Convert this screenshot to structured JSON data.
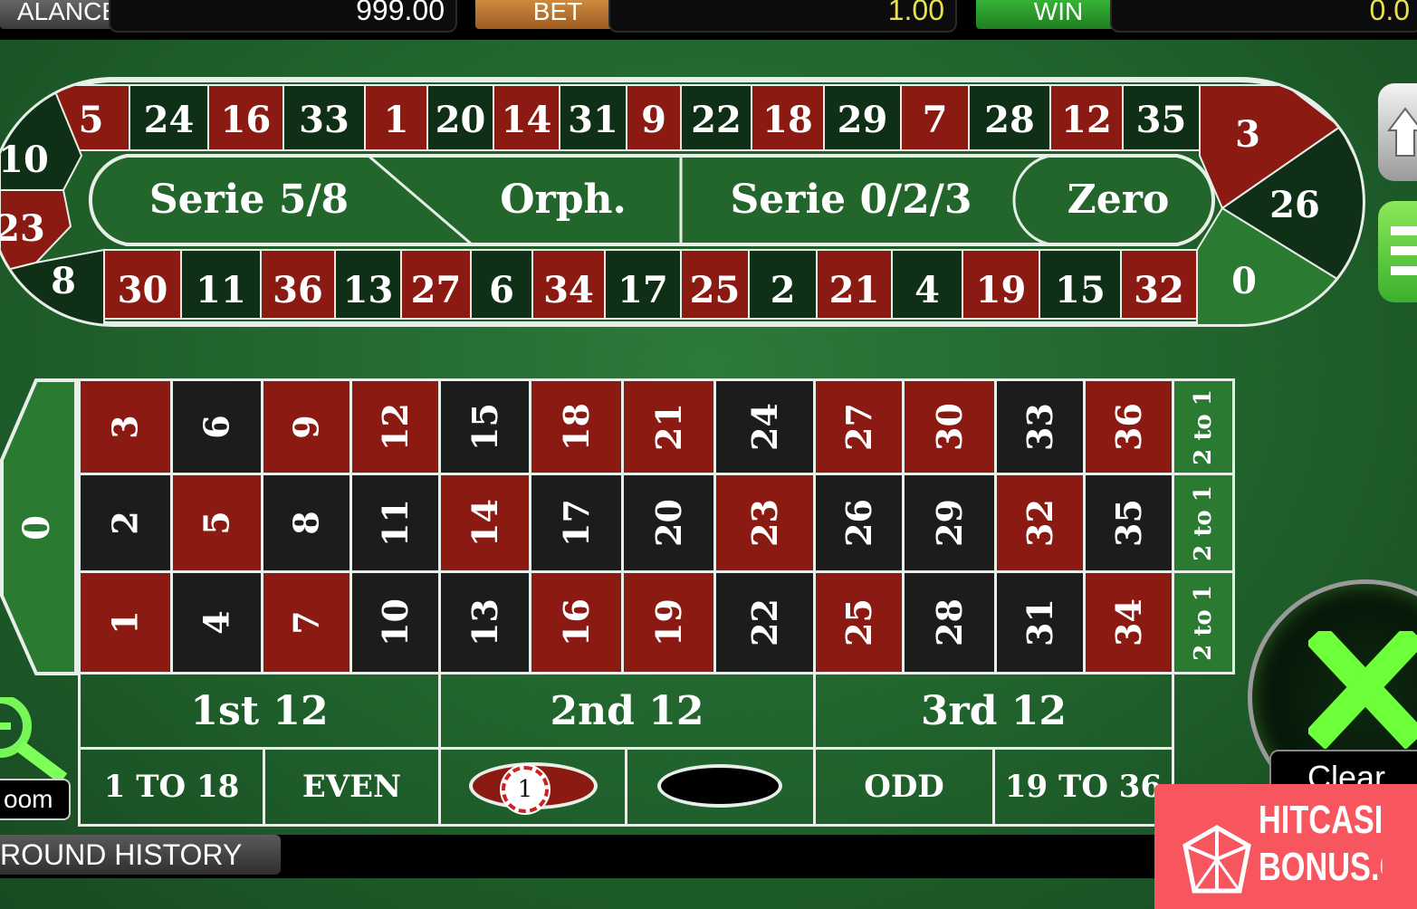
{
  "topbar": {
    "balance_label": "ALANCE",
    "balance_value": "999.00",
    "bet_label": "BET",
    "bet_value": "1.00",
    "win_label": "WIN",
    "win_value": "0.0",
    "colors": {
      "bet": "#b8742e",
      "win": "#2f9b2f"
    }
  },
  "racetrack": {
    "top_row": [
      "5",
      "24",
      "16",
      "33",
      "1",
      "20",
      "14",
      "31",
      "9",
      "22",
      "18",
      "29",
      "7",
      "28",
      "12",
      "35"
    ],
    "bottom_row": [
      "30",
      "11",
      "36",
      "13",
      "27",
      "6",
      "34",
      "17",
      "25",
      "2",
      "21",
      "4",
      "19",
      "15",
      "32"
    ],
    "left_end": [
      "10",
      "23",
      "8"
    ],
    "right_end": [
      "3",
      "26",
      "0"
    ],
    "sections": [
      "Serie 5/8",
      "Orph.",
      "Serie 0/2/3",
      "Zero"
    ]
  },
  "table": {
    "zero": "0",
    "rows": [
      [
        "3",
        "6",
        "9",
        "12",
        "15",
        "18",
        "21",
        "24",
        "27",
        "30",
        "33",
        "36"
      ],
      [
        "2",
        "5",
        "8",
        "11",
        "14",
        "17",
        "20",
        "23",
        "26",
        "29",
        "32",
        "35"
      ],
      [
        "1",
        "4",
        "7",
        "10",
        "13",
        "16",
        "19",
        "22",
        "25",
        "28",
        "31",
        "34"
      ]
    ],
    "red_numbers": [
      1,
      3,
      5,
      7,
      9,
      12,
      14,
      16,
      18,
      19,
      21,
      23,
      25,
      27,
      30,
      32,
      34,
      36
    ],
    "column_bets": [
      "2 to 1",
      "2 to 1",
      "2 to 1"
    ],
    "dozens": [
      "1st 12",
      "2nd 12",
      "3rd 12"
    ],
    "even_bets": [
      "1 TO 18",
      "EVEN",
      "",
      "",
      "ODD",
      "19 TO 36"
    ],
    "chip_value": "1"
  },
  "controls": {
    "zoom_label": "oom",
    "clear_label": "Clear"
  },
  "history": {
    "label": "ROUND HISTORY"
  },
  "watermark": {
    "line1": "HITCASINO",
    "line2": "BONUS.COM"
  },
  "colors": {
    "felt": "#236b2f",
    "red": "#8a1a12",
    "black": "#1c1c1c",
    "green": "#2b7a31"
  }
}
